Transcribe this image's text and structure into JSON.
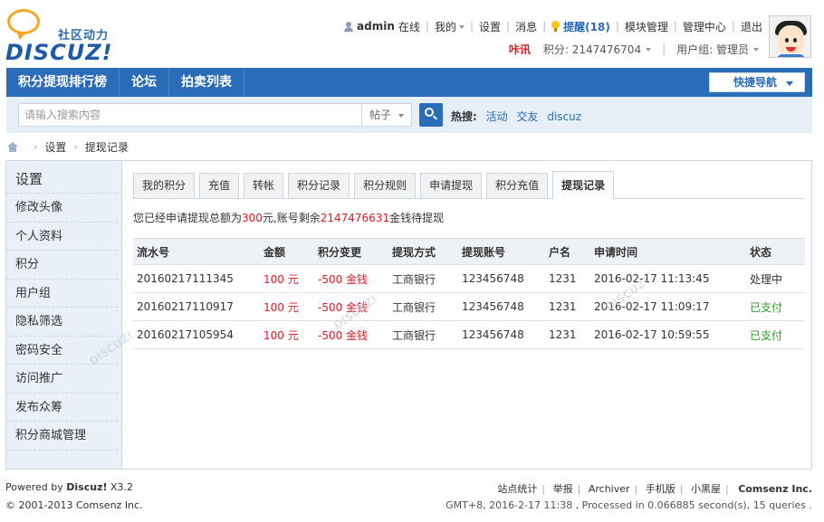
{
  "logo": {
    "cn": "社区动力",
    "en": "DISCUZ!"
  },
  "topbar": {
    "username": "admin",
    "online": "在线",
    "my": "我的",
    "settings": "设置",
    "messages": "消息",
    "remind": "提醒(18)",
    "module_manage": "模块管理",
    "admin_center": "管理中心",
    "logout": "退出"
  },
  "secondbar": {
    "brand": "咔讯",
    "credits": "积分: 2147476704",
    "usergroup": "用户组: 管理员"
  },
  "nav": {
    "items": [
      "积分提现排行榜",
      "论坛",
      "拍卖列表"
    ],
    "quick": "快捷导航"
  },
  "search": {
    "placeholder": "请输入搜索内容",
    "type": "帖子",
    "hot_label": "热搜:",
    "hot": [
      "活动",
      "交友",
      "discuz"
    ]
  },
  "breadcrumb": [
    "设置",
    "提现记录"
  ],
  "sidebar": {
    "title": "设置",
    "items": [
      "修改头像",
      "个人资料",
      "积分",
      "用户组",
      "隐私筛选",
      "密码安全",
      "访问推广",
      "发布众筹",
      "积分商城管理"
    ]
  },
  "tabs": [
    "我的积分",
    "充值",
    "转帐",
    "积分记录",
    "积分规则",
    "申请提现",
    "积分充值",
    "提现记录"
  ],
  "summary": {
    "prefix": "您已经申请提现总额为",
    "total": "300",
    "middle": "元,账号剩余",
    "remain": "2147476631",
    "suffix": "金钱待提现"
  },
  "table": {
    "headers": [
      "流水号",
      "金额",
      "积分变更",
      "提现方式",
      "提现账号",
      "户名",
      "申请时间",
      "状态"
    ],
    "rows": [
      [
        "20160217111345",
        "100 元",
        "-500 金钱",
        "工商银行",
        "123456748",
        "1231",
        "2016-02-17 11:13:45",
        "处理中"
      ],
      [
        "20160217110917",
        "100 元",
        "-500 金钱",
        "工商银行",
        "123456748",
        "1231",
        "2016-02-17 11:09:17",
        "已支付"
      ],
      [
        "20160217105954",
        "100 元",
        "-500 金钱",
        "工商银行",
        "123456748",
        "1231",
        "2016-02-17 10:59:55",
        "已支付"
      ]
    ]
  },
  "footer": {
    "powered_prefix": "Powered by",
    "powered_name": "Discuz!",
    "version": "X3.2",
    "copyright": "© 2001-2013 Comsenz Inc.",
    "links": [
      "站点统计",
      "举报",
      "Archiver",
      "手机版",
      "小黑屋"
    ],
    "company": "Comsenz Inc.",
    "stats": "GMT+8, 2016-2-17 11:38 , Processed in 0.066885 second(s), 15 queries ."
  },
  "colors": {
    "brand": "#2b6cb8",
    "red": "#e4161f",
    "green": "#2a9d1f"
  }
}
